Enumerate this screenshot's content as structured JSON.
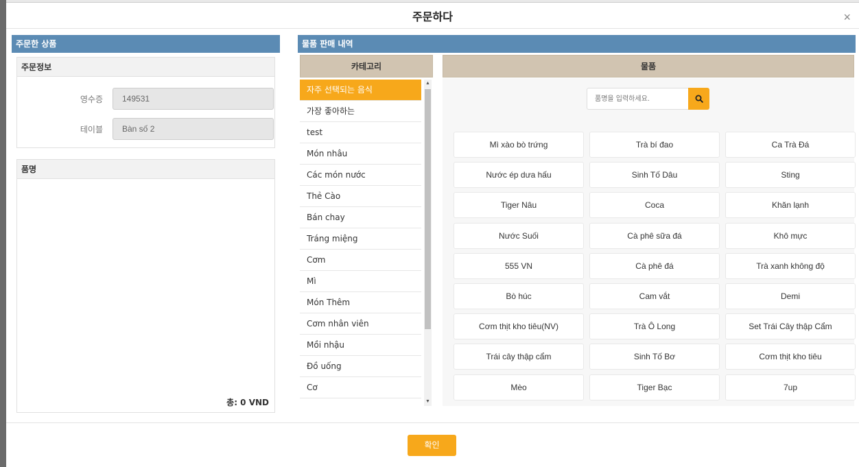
{
  "modal": {
    "title": "주문하다",
    "close": "×"
  },
  "left_panel": {
    "header": "주문한 상품",
    "order_info": {
      "title": "주문정보",
      "receipt_label": "영수증",
      "receipt_value": "149531",
      "table_label": "테이블",
      "table_value": "Bàn số 2"
    },
    "item_list": {
      "title": "품명",
      "total": "총: 0 VND"
    }
  },
  "right_panel": {
    "header": "물품 판매 내역",
    "category_header": "카테고리",
    "product_header": "물품",
    "categories": [
      {
        "label": "자주 선택되는 음식",
        "active": true
      },
      {
        "label": "가장 좋아하는",
        "active": false
      },
      {
        "label": "test",
        "active": false
      },
      {
        "label": "Món nhâu",
        "active": false
      },
      {
        "label": "Các món nước",
        "active": false
      },
      {
        "label": "Thẻ Cào",
        "active": false
      },
      {
        "label": "Bán chay",
        "active": false
      },
      {
        "label": "Tráng miệng",
        "active": false
      },
      {
        "label": "Cơm",
        "active": false
      },
      {
        "label": "Mì",
        "active": false
      },
      {
        "label": "Món Thêm",
        "active": false
      },
      {
        "label": "Cơm nhân viên",
        "active": false
      },
      {
        "label": "Mồi nhậu",
        "active": false
      },
      {
        "label": "Đồ uống",
        "active": false
      },
      {
        "label": "Cơ",
        "active": false
      }
    ],
    "search": {
      "placeholder": "품명을 입력하세요.",
      "icon": "search-icon"
    },
    "products": [
      "Mì xào bò trứng",
      "Trà bí đao",
      "Ca Trà Đá",
      "Nước ép dưa hấu",
      "Sinh Tố Dâu",
      "Sting",
      "Tiger Nâu",
      "Coca",
      "Khăn lạnh",
      "Nước Suối",
      "Cà phê sữa đá",
      "Khô mực",
      "555 VN",
      "Cà phê đá",
      "Trà xanh không độ",
      "Bò húc",
      "Cam vắt",
      "Demi",
      "Cơm thịt kho tiêu(NV)",
      "Trà Ô Long",
      "Set Trái Cây thập Cẩm",
      "Trái cây thập cẩm",
      "Sinh Tố Bơ",
      "Cơm thịt kho tiêu",
      "Mèo",
      "Tiger Bạc",
      "7up"
    ]
  },
  "footer": {
    "confirm": "확인"
  },
  "colors": {
    "panel_header": "#5b8bb4",
    "accent": "#f7a81b",
    "category_header": "#d1c4b1"
  }
}
